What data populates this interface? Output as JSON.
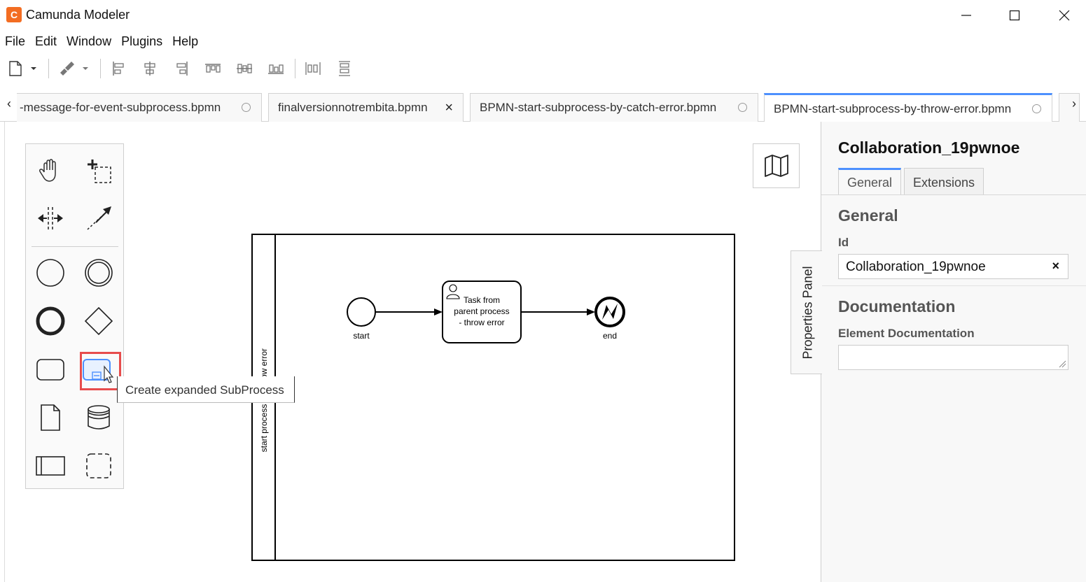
{
  "window": {
    "title": "Camunda Modeler",
    "icon_letter": "C"
  },
  "menu": [
    "File",
    "Edit",
    "Window",
    "Plugins",
    "Help"
  ],
  "tabs": [
    {
      "label": "-message-for-event-subprocess.bpmn",
      "state": "saved"
    },
    {
      "label": "finalversionnotrembita.bpmn",
      "state": "close"
    },
    {
      "label": "BPMN-start-subprocess-by-catch-error.bpmn",
      "state": "saved"
    },
    {
      "label": "BPMN-start-subprocess-by-throw-error.bpmn",
      "state": "saved",
      "active": true
    }
  ],
  "tab_arrows": {
    "left": "‹",
    "right": "›"
  },
  "tooltip": "Create expanded SubProcess",
  "diagram": {
    "pool_label": "start process by throw error",
    "pool_label_visible_top": "ow error",
    "pool_label_visible_bottom": "start process",
    "start_label": "start",
    "task_lines": [
      "Task from",
      "parent process",
      "- throw error"
    ],
    "end_label": "end"
  },
  "properties": {
    "toggle_label": "Properties Panel",
    "title": "Collaboration_19pwnoe",
    "tabs": [
      "General",
      "Extensions"
    ],
    "group_general": "General",
    "id_label": "Id",
    "id_value": "Collaboration_19pwnoe",
    "clear_glyph": "×",
    "group_documentation": "Documentation",
    "doc_label": "Element Documentation"
  },
  "colors": {
    "accent": "#4d90fe",
    "highlight": "#e74c4c",
    "brand": "#f36d22"
  }
}
